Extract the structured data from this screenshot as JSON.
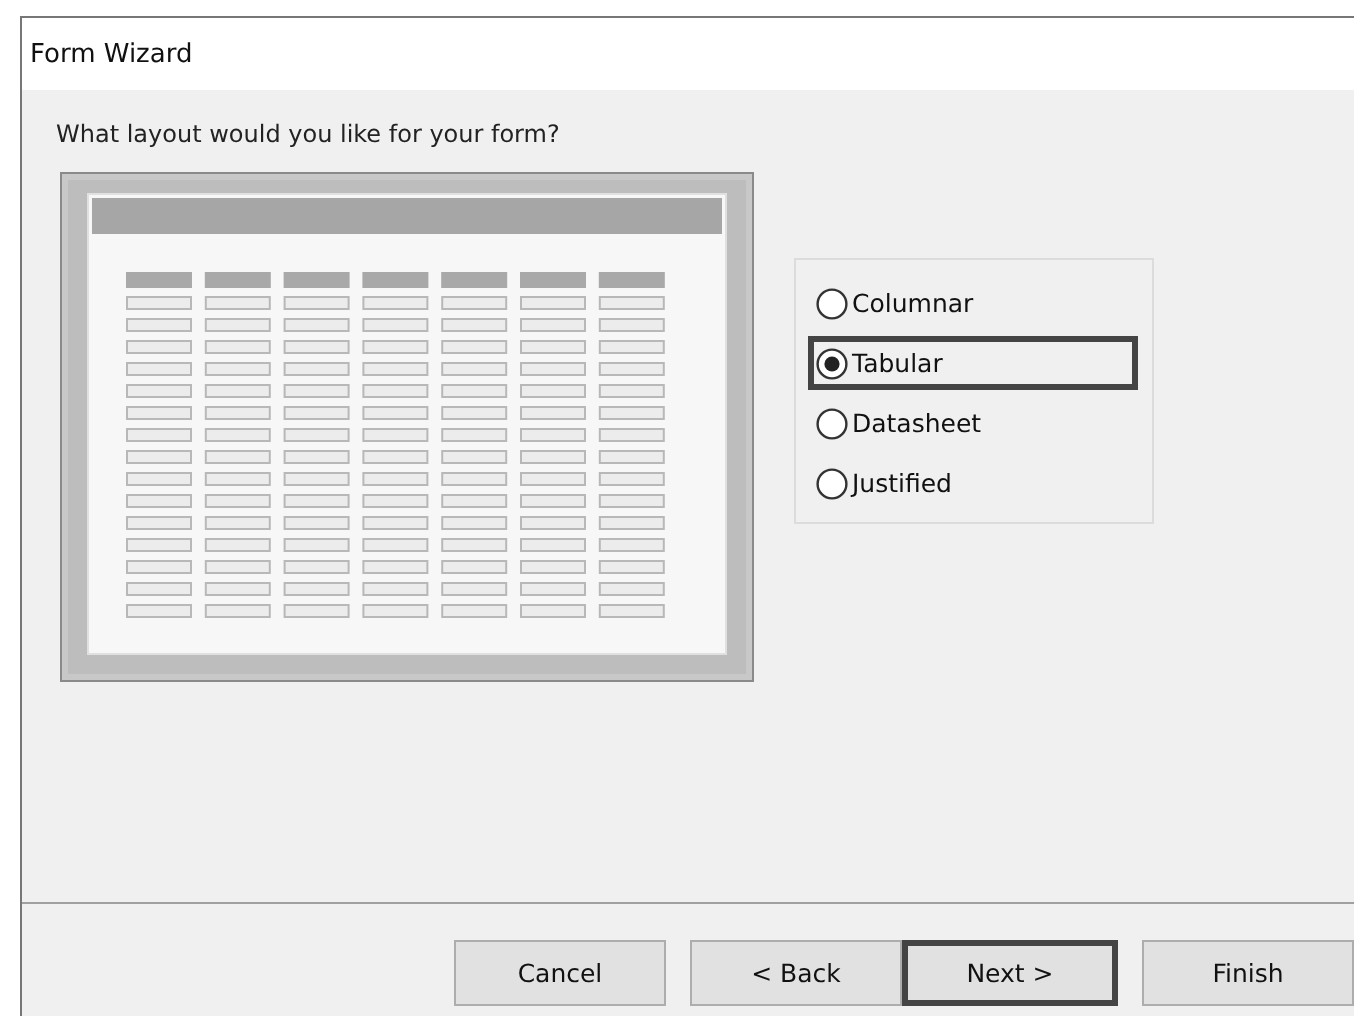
{
  "window": {
    "title": "Form Wizard"
  },
  "question": "What layout would you like for your form?",
  "layout_options": [
    {
      "label": "Columnar",
      "selected": false,
      "focused": false
    },
    {
      "label": "Tabular",
      "selected": true,
      "focused": true
    },
    {
      "label": "Datasheet",
      "selected": false,
      "focused": false
    },
    {
      "label": "Justified",
      "selected": false,
      "focused": false
    }
  ],
  "buttons": [
    {
      "label": "Cancel",
      "default": false
    },
    {
      "label": "< Back",
      "default": false
    },
    {
      "label": "Next >",
      "default": true
    },
    {
      "label": "Finish",
      "default": false
    }
  ]
}
